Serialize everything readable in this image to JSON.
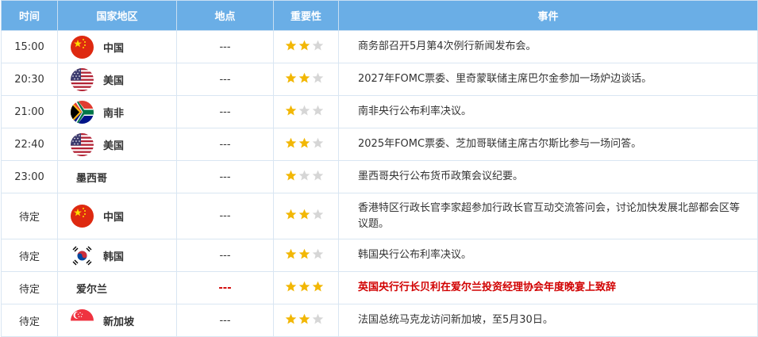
{
  "headers": {
    "time": "时间",
    "country": "国家地区",
    "location": "地点",
    "importance": "重要性",
    "event": "事件"
  },
  "colors": {
    "header_bg": "#6aaee6",
    "star_on": "#f2b705",
    "star_off": "#d6d6d6",
    "highlight": "#d10000"
  },
  "rows": [
    {
      "time": "15:00",
      "country": "中国",
      "flag": "china-flag-icon",
      "location": "---",
      "stars": 2,
      "event": "商务部召开5月第4次例行新闻发布会。"
    },
    {
      "time": "20:30",
      "country": "美国",
      "flag": "usa-flag-icon",
      "location": "---",
      "stars": 2,
      "event": "2027年FOMC票委、里奇蒙联储主席巴尔金参加一场炉边谈话。"
    },
    {
      "time": "21:00",
      "country": "南非",
      "flag": "south-africa-flag-icon",
      "location": "---",
      "stars": 1,
      "event": "南非央行公布利率决议。"
    },
    {
      "time": "22:40",
      "country": "美国",
      "flag": "usa-flag-icon",
      "location": "---",
      "stars": 2,
      "event": "2025年FOMC票委、芝加哥联储主席古尔斯比参与一场问答。"
    },
    {
      "time": "23:00",
      "country": "墨西哥",
      "flag": "",
      "location": "---",
      "stars": 1,
      "event": "墨西哥央行公布货币政策会议纪要。"
    },
    {
      "time": "待定",
      "country": "中国",
      "flag": "china-flag-icon",
      "location": "---",
      "stars": 2,
      "event": "香港特区行政长官李家超参加行政长官互动交流答问会，讨论加快发展北部都会区等议题。"
    },
    {
      "time": "待定",
      "country": "韩国",
      "flag": "korea-flag-icon",
      "location": "---",
      "stars": 2,
      "event": "韩国央行公布利率决议。"
    },
    {
      "time": "待定",
      "country": "爱尔兰",
      "flag": "",
      "location": "---",
      "stars": 3,
      "event": "英国央行行长贝利在爱尔兰投资经理协会年度晚宴上致辞",
      "highlight": true
    },
    {
      "time": "待定",
      "country": "新加坡",
      "flag": "singapore-flag-icon",
      "location": "---",
      "stars": 2,
      "event": "法国总统马克龙访问新加坡，至5月30日。"
    }
  ]
}
